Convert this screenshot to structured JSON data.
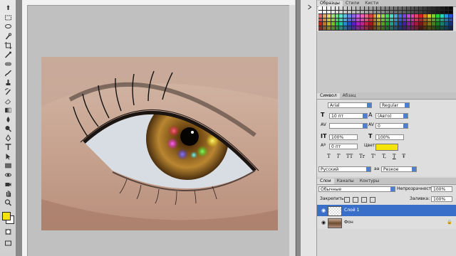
{
  "swatches_panel": {
    "tabs": [
      "Образцы",
      "Стили",
      "Кисти"
    ]
  },
  "character_panel": {
    "tabs": [
      "Символ",
      "Абзац"
    ],
    "font_family": "Arial",
    "font_style": "Regular",
    "font_size": "10 пт",
    "leading": "(Авто)",
    "kerning": "",
    "tracking": "0",
    "vertical_scale": "100%",
    "horizontal_scale": "100%",
    "baseline_shift": "0 пт",
    "color_label": "Цвет:",
    "color": "#f4e40a",
    "style_buttons": [
      "T",
      "T",
      "TT",
      "Tr",
      "T'",
      "T,",
      "T",
      "Ŧ"
    ],
    "language": "Русский",
    "antialias_icon": "aa",
    "antialias": "Резкое"
  },
  "layers_panel": {
    "tabs": [
      "Слои",
      "Каналы",
      "Контуры"
    ],
    "blend_mode": "Обычные",
    "opacity_label": "Непрозрачность:",
    "opacity": "100%",
    "lock_label": "Закрепить:",
    "fill_label": "Заливка:",
    "fill": "100%",
    "layers": [
      {
        "name": "Слой 1",
        "selected": true
      },
      {
        "name": "Фон",
        "selected": false
      }
    ]
  },
  "colors": {
    "accent": "#3a6fc9",
    "foreground": "#f4e40a",
    "background": "#ffffff"
  },
  "tools": [
    "move-tool-icon",
    "marquee-tool-icon",
    "lasso-tool-icon",
    "quick-select-tool-icon",
    "crop-tool-icon",
    "eyedropper-tool-icon",
    "healing-brush-icon",
    "brush-tool-icon",
    "clone-stamp-icon",
    "history-brush-icon",
    "eraser-tool-icon",
    "gradient-tool-icon",
    "blur-tool-icon",
    "dodge-tool-icon",
    "pen-tool-icon",
    "type-tool-icon",
    "path-select-icon",
    "shape-tool-icon",
    "3d-rotate-icon",
    "3d-camera-icon",
    "hand-tool-icon",
    "zoom-tool-icon"
  ]
}
